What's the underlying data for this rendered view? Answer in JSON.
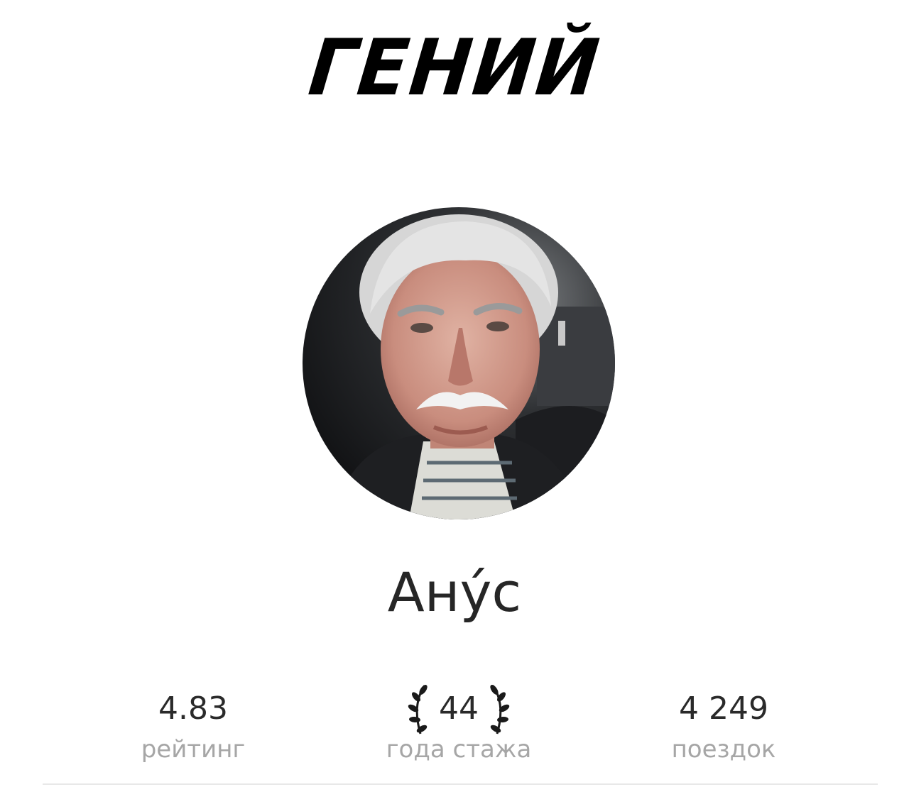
{
  "header": {
    "title": "ГЕНИЙ"
  },
  "profile": {
    "avatar_icon": "driver-photo",
    "name": "Ану́с"
  },
  "stats": {
    "rating": {
      "value": "4.83",
      "label": "рейтинг"
    },
    "experience": {
      "value": "44",
      "label": "года стажа",
      "icon": "laurel-wreath-icon"
    },
    "trips": {
      "value": "4 249",
      "label": "поездок"
    }
  },
  "colors": {
    "title": "#000000",
    "name": "#262626",
    "value": "#2a2a2a",
    "label": "#a6a6a6"
  }
}
